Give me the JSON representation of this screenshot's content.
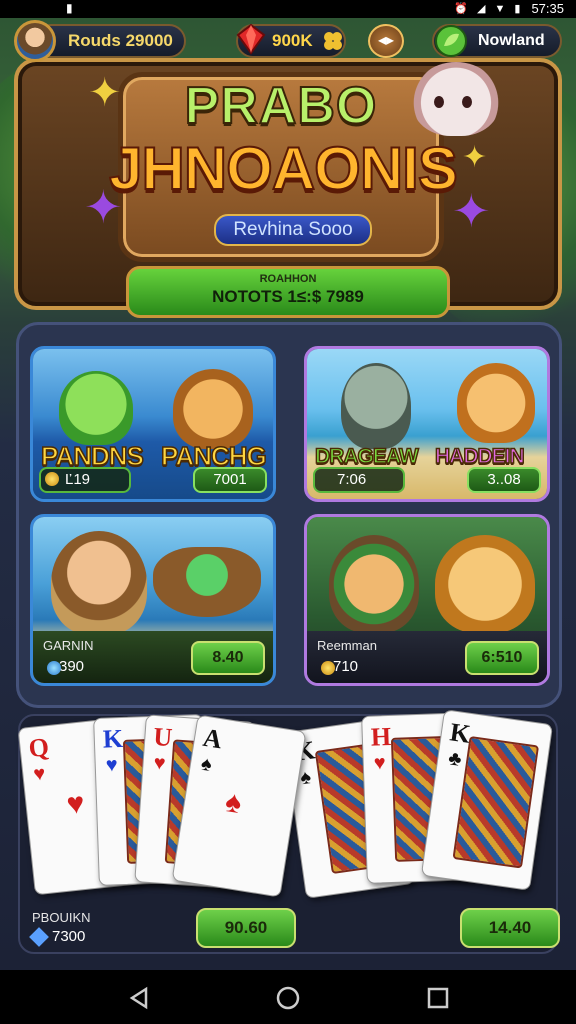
{
  "status_bar": {
    "left_icon": "notification-icon",
    "time": "57:35",
    "icons": [
      "alarm-icon",
      "wifi-icon",
      "signal-icon",
      "battery-icon"
    ]
  },
  "hud": {
    "username": "Rouds 29000",
    "gems": "900K",
    "status": "Nowland",
    "back_icon": "arrow-left-right-icon",
    "colors": {
      "accent": "#c9963a",
      "gold": "#f6d86a"
    }
  },
  "banner": {
    "line1": "PRABO",
    "line2": "JHNOAONIS",
    "tag": "Revhina Sooo",
    "play_small": "ROAHHON",
    "play_main": "NOTOTS 1≤:$ 7989"
  },
  "tiles": [
    {
      "title_a": "PANDNS",
      "title_b": "PANCHG",
      "stat_left": "Ľ19",
      "stat_right": "7001"
    },
    {
      "title_a": "DRAGEAW",
      "title_b": "HADDEIN",
      "stat_left": "7:06",
      "stat_right": "3..08"
    },
    {
      "label": "GARNIN",
      "value": "390",
      "button": "8.40"
    },
    {
      "label": "Reemman",
      "value": "710",
      "button": "6:510"
    }
  ],
  "cards": {
    "left_hand": [
      {
        "rank": "Q",
        "suit": "♥",
        "color": "red"
      },
      {
        "rank": "K",
        "suit": "♥",
        "color": "blue"
      },
      {
        "rank": "U",
        "suit": "♥",
        "color": "red"
      },
      {
        "rank": "A",
        "suit": "♠",
        "color": "black"
      }
    ],
    "right_hand": [
      {
        "rank": "K",
        "suit": "♠",
        "color": "black"
      },
      {
        "rank": "H",
        "suit": "♥",
        "color": "red"
      },
      {
        "rank": "K",
        "suit": "♣",
        "color": "black"
      }
    ],
    "label": "PBOUIKN",
    "value": "7300",
    "button_left": "90.60",
    "button_right": "14.40"
  },
  "nav": [
    "back-icon",
    "home-icon",
    "recents-icon"
  ]
}
